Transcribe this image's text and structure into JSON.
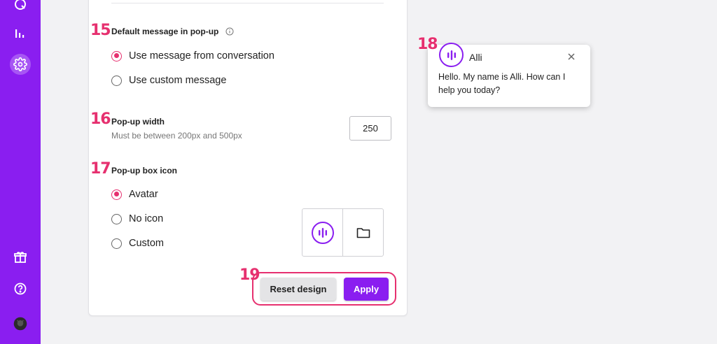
{
  "sidebar": {
    "items": [
      {
        "icon": "chat-search-icon"
      },
      {
        "icon": "bar-chart-icon"
      },
      {
        "icon": "gear-icon",
        "active": true
      },
      {
        "icon": "gift-icon"
      },
      {
        "icon": "help-icon"
      },
      {
        "icon": "user-avatar-icon"
      }
    ]
  },
  "annotations": {
    "step15": "15",
    "step16": "16",
    "step17": "17",
    "step18": "18",
    "step19": "19"
  },
  "default_message": {
    "title": "Default message in pop-up",
    "options": [
      {
        "label": "Use message from conversation",
        "checked": true
      },
      {
        "label": "Use custom message",
        "checked": false
      }
    ]
  },
  "popup_width": {
    "title": "Pop-up width",
    "hint": "Must be between 200px and 500px",
    "value": "250"
  },
  "popup_icon": {
    "title": "Pop-up box icon",
    "options": [
      {
        "label": "Avatar",
        "checked": true
      },
      {
        "label": "No icon",
        "checked": false
      },
      {
        "label": "Custom",
        "checked": false
      }
    ],
    "picker": [
      "avatar-icon",
      "folder-icon"
    ]
  },
  "actions": {
    "reset_label": "Reset design",
    "apply_label": "Apply"
  },
  "preview": {
    "name": "Alli",
    "message": "Hello. My name is Alli. How can I help you today?"
  },
  "colors": {
    "brand": "#8a1ef0",
    "accent": "#e6306f"
  }
}
